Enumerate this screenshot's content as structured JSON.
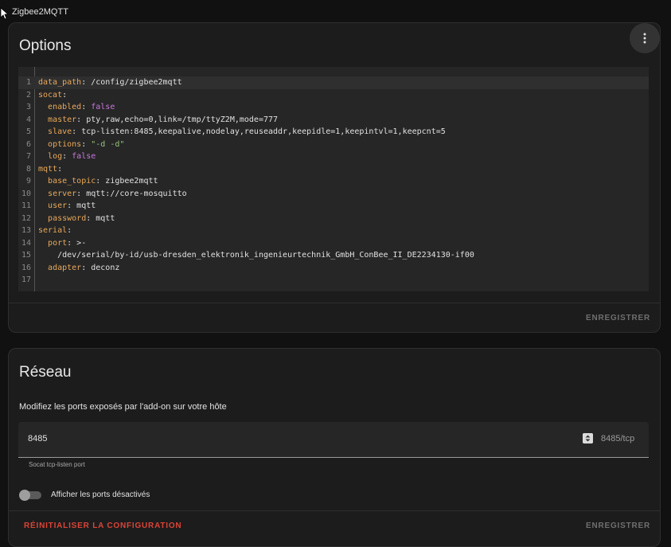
{
  "app": {
    "title": "Zigbee2MQTT"
  },
  "options": {
    "title": "Options",
    "menu_icon": "dots-vertical-icon",
    "save_label": "ENREGISTRER",
    "lines": [
      {
        "n": "1",
        "segs": [
          [
            "k",
            "data_path"
          ],
          [
            "p",
            ": /config/zigbee2mqtt"
          ]
        ]
      },
      {
        "n": "2",
        "segs": [
          [
            "k",
            "socat"
          ],
          [
            "p",
            ":"
          ]
        ]
      },
      {
        "n": "3",
        "segs": [
          [
            "p",
            "  "
          ],
          [
            "k",
            "enabled"
          ],
          [
            "p",
            ": "
          ],
          [
            "b",
            "false"
          ]
        ]
      },
      {
        "n": "4",
        "segs": [
          [
            "p",
            "  "
          ],
          [
            "k",
            "master"
          ],
          [
            "p",
            ": pty,raw,echo=0,link=/tmp/ttyZ2M,mode=777"
          ]
        ]
      },
      {
        "n": "5",
        "segs": [
          [
            "p",
            "  "
          ],
          [
            "k",
            "slave"
          ],
          [
            "p",
            ": tcp-listen:8485,keepalive,nodelay,reuseaddr,keepidle=1,keepintvl=1,keepcnt=5"
          ]
        ]
      },
      {
        "n": "6",
        "segs": [
          [
            "p",
            "  "
          ],
          [
            "k",
            "options"
          ],
          [
            "p",
            ": "
          ],
          [
            "s",
            "\"-d -d\""
          ]
        ]
      },
      {
        "n": "7",
        "segs": [
          [
            "p",
            "  "
          ],
          [
            "k",
            "log"
          ],
          [
            "p",
            ": "
          ],
          [
            "b",
            "false"
          ]
        ]
      },
      {
        "n": "8",
        "segs": [
          [
            "k",
            "mqtt"
          ],
          [
            "p",
            ":"
          ]
        ]
      },
      {
        "n": "9",
        "segs": [
          [
            "p",
            "  "
          ],
          [
            "k",
            "base_topic"
          ],
          [
            "p",
            ": zigbee2mqtt"
          ]
        ]
      },
      {
        "n": "10",
        "segs": [
          [
            "p",
            "  "
          ],
          [
            "k",
            "server"
          ],
          [
            "p",
            ": mqtt://core-mosquitto"
          ]
        ]
      },
      {
        "n": "11",
        "segs": [
          [
            "p",
            "  "
          ],
          [
            "k",
            "user"
          ],
          [
            "p",
            ": mqtt"
          ]
        ]
      },
      {
        "n": "12",
        "segs": [
          [
            "p",
            "  "
          ],
          [
            "k",
            "password"
          ],
          [
            "p",
            ": mqtt"
          ]
        ]
      },
      {
        "n": "13",
        "segs": [
          [
            "k",
            "serial"
          ],
          [
            "p",
            ":"
          ]
        ]
      },
      {
        "n": "14",
        "segs": [
          [
            "p",
            "  "
          ],
          [
            "k",
            "port"
          ],
          [
            "p",
            ": >-"
          ]
        ]
      },
      {
        "n": "15",
        "segs": [
          [
            "p",
            "    /dev/serial/by-id/usb-dresden_elektronik_ingenieurtechnik_GmbH_ConBee_II_DE2234130-if00"
          ]
        ]
      },
      {
        "n": "16",
        "segs": [
          [
            "p",
            "  "
          ],
          [
            "k",
            "adapter"
          ],
          [
            "p",
            ": deconz"
          ]
        ]
      },
      {
        "n": "17",
        "segs": []
      }
    ]
  },
  "network": {
    "title": "Réseau",
    "description": "Modifiez les ports exposés par l'add-on sur votre hôte",
    "port_value": "8485",
    "port_suffix": "8485/tcp",
    "helper": "Socat tcp-listen port",
    "toggle_label": "Afficher les ports désactivés",
    "reset_label": "RÉINITIALISER LA CONFIGURATION",
    "save_label": "ENREGISTRER"
  }
}
